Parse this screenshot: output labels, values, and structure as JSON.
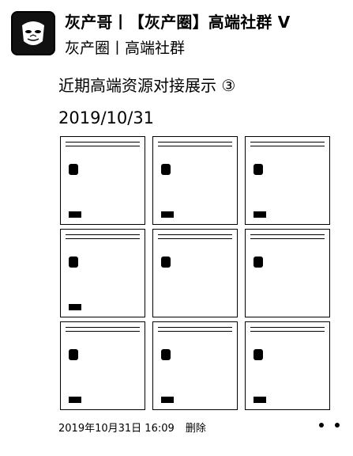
{
  "header": {
    "author_name": "灰产哥丨【灰产圈】高端社群",
    "verified_mark": "V",
    "author_sub": "灰产圈丨高端社群"
  },
  "post": {
    "title": "近期高端资源对接展示 ③",
    "date": "2019/10/31"
  },
  "meta": {
    "timestamp": "2019年10月31日 16:09",
    "delete_label": "删除"
  },
  "colors": {
    "background": "#ffffff",
    "text": "#000000"
  }
}
